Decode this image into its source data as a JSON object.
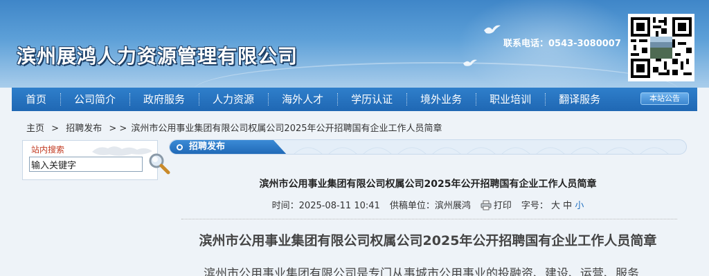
{
  "header": {
    "site_title": "滨州展鸿人力资源管理有限公司",
    "hotline": "联系电话：0543-3080007"
  },
  "nav": {
    "items": [
      {
        "label": "首页"
      },
      {
        "label": "公司简介"
      },
      {
        "label": "政府服务"
      },
      {
        "label": "人力资源"
      },
      {
        "label": "海外人才"
      },
      {
        "label": "学历认证"
      },
      {
        "label": "境外业务"
      },
      {
        "label": "职业培训"
      },
      {
        "label": "翻译服务"
      }
    ],
    "notice_label": "本站公告"
  },
  "breadcrumb": {
    "home": "主页",
    "sep1": ">",
    "category": "招聘发布",
    "sep2": "> >",
    "current": "滨州市公用事业集团有限公司权属公司2025年公开招聘国有企业工作人员简章"
  },
  "search": {
    "label": "站内搜索",
    "value": "输入关键字"
  },
  "section": {
    "label": "招聘发布"
  },
  "article": {
    "title": "滨州市公用事业集团有限公司权属公司2025年公开招聘国有企业工作人员简章",
    "time_label": "时间：",
    "time_value": "2025-08-11 10:41",
    "source_label": "供稿单位：",
    "source_value": "滨州展鸿",
    "print_label": "打印",
    "font_size_label": "字号：",
    "size_large": "大",
    "size_medium": "中",
    "size_small": "小",
    "heading": "滨州市公用事业集团有限公司权属公司2025年公开招聘国有企业工作人员简章",
    "body_first_line": "滨州市公用事业集团有限公司是专门从事城市公用事业的投融资、建设、运营、服务"
  },
  "colors": {
    "nav_bg": "#1f67b3",
    "header_bg": "#4a92d0",
    "search_label": "#c23b22",
    "accent_link": "#1f6fc0"
  },
  "icons": {
    "search": "magnifier-icon",
    "print": "printer-icon",
    "qr": "qr-code-icon"
  }
}
